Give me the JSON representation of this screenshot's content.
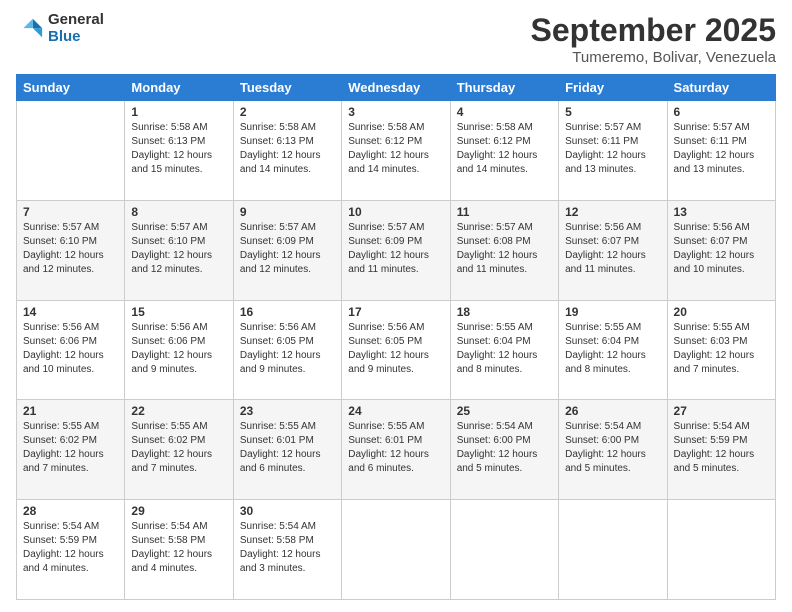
{
  "logo": {
    "general": "General",
    "blue": "Blue"
  },
  "title": "September 2025",
  "subtitle": "Tumeremo, Bolivar, Venezuela",
  "weekdays": [
    "Sunday",
    "Monday",
    "Tuesday",
    "Wednesday",
    "Thursday",
    "Friday",
    "Saturday"
  ],
  "weeks": [
    [
      {
        "day": "",
        "sunrise": "",
        "sunset": "",
        "daylight": ""
      },
      {
        "day": "1",
        "sunrise": "Sunrise: 5:58 AM",
        "sunset": "Sunset: 6:13 PM",
        "daylight": "Daylight: 12 hours and 15 minutes."
      },
      {
        "day": "2",
        "sunrise": "Sunrise: 5:58 AM",
        "sunset": "Sunset: 6:13 PM",
        "daylight": "Daylight: 12 hours and 14 minutes."
      },
      {
        "day": "3",
        "sunrise": "Sunrise: 5:58 AM",
        "sunset": "Sunset: 6:12 PM",
        "daylight": "Daylight: 12 hours and 14 minutes."
      },
      {
        "day": "4",
        "sunrise": "Sunrise: 5:58 AM",
        "sunset": "Sunset: 6:12 PM",
        "daylight": "Daylight: 12 hours and 14 minutes."
      },
      {
        "day": "5",
        "sunrise": "Sunrise: 5:57 AM",
        "sunset": "Sunset: 6:11 PM",
        "daylight": "Daylight: 12 hours and 13 minutes."
      },
      {
        "day": "6",
        "sunrise": "Sunrise: 5:57 AM",
        "sunset": "Sunset: 6:11 PM",
        "daylight": "Daylight: 12 hours and 13 minutes."
      }
    ],
    [
      {
        "day": "7",
        "sunrise": "Sunrise: 5:57 AM",
        "sunset": "Sunset: 6:10 PM",
        "daylight": "Daylight: 12 hours and 12 minutes."
      },
      {
        "day": "8",
        "sunrise": "Sunrise: 5:57 AM",
        "sunset": "Sunset: 6:10 PM",
        "daylight": "Daylight: 12 hours and 12 minutes."
      },
      {
        "day": "9",
        "sunrise": "Sunrise: 5:57 AM",
        "sunset": "Sunset: 6:09 PM",
        "daylight": "Daylight: 12 hours and 12 minutes."
      },
      {
        "day": "10",
        "sunrise": "Sunrise: 5:57 AM",
        "sunset": "Sunset: 6:09 PM",
        "daylight": "Daylight: 12 hours and 11 minutes."
      },
      {
        "day": "11",
        "sunrise": "Sunrise: 5:57 AM",
        "sunset": "Sunset: 6:08 PM",
        "daylight": "Daylight: 12 hours and 11 minutes."
      },
      {
        "day": "12",
        "sunrise": "Sunrise: 5:56 AM",
        "sunset": "Sunset: 6:07 PM",
        "daylight": "Daylight: 12 hours and 11 minutes."
      },
      {
        "day": "13",
        "sunrise": "Sunrise: 5:56 AM",
        "sunset": "Sunset: 6:07 PM",
        "daylight": "Daylight: 12 hours and 10 minutes."
      }
    ],
    [
      {
        "day": "14",
        "sunrise": "Sunrise: 5:56 AM",
        "sunset": "Sunset: 6:06 PM",
        "daylight": "Daylight: 12 hours and 10 minutes."
      },
      {
        "day": "15",
        "sunrise": "Sunrise: 5:56 AM",
        "sunset": "Sunset: 6:06 PM",
        "daylight": "Daylight: 12 hours and 9 minutes."
      },
      {
        "day": "16",
        "sunrise": "Sunrise: 5:56 AM",
        "sunset": "Sunset: 6:05 PM",
        "daylight": "Daylight: 12 hours and 9 minutes."
      },
      {
        "day": "17",
        "sunrise": "Sunrise: 5:56 AM",
        "sunset": "Sunset: 6:05 PM",
        "daylight": "Daylight: 12 hours and 9 minutes."
      },
      {
        "day": "18",
        "sunrise": "Sunrise: 5:55 AM",
        "sunset": "Sunset: 6:04 PM",
        "daylight": "Daylight: 12 hours and 8 minutes."
      },
      {
        "day": "19",
        "sunrise": "Sunrise: 5:55 AM",
        "sunset": "Sunset: 6:04 PM",
        "daylight": "Daylight: 12 hours and 8 minutes."
      },
      {
        "day": "20",
        "sunrise": "Sunrise: 5:55 AM",
        "sunset": "Sunset: 6:03 PM",
        "daylight": "Daylight: 12 hours and 7 minutes."
      }
    ],
    [
      {
        "day": "21",
        "sunrise": "Sunrise: 5:55 AM",
        "sunset": "Sunset: 6:02 PM",
        "daylight": "Daylight: 12 hours and 7 minutes."
      },
      {
        "day": "22",
        "sunrise": "Sunrise: 5:55 AM",
        "sunset": "Sunset: 6:02 PM",
        "daylight": "Daylight: 12 hours and 7 minutes."
      },
      {
        "day": "23",
        "sunrise": "Sunrise: 5:55 AM",
        "sunset": "Sunset: 6:01 PM",
        "daylight": "Daylight: 12 hours and 6 minutes."
      },
      {
        "day": "24",
        "sunrise": "Sunrise: 5:55 AM",
        "sunset": "Sunset: 6:01 PM",
        "daylight": "Daylight: 12 hours and 6 minutes."
      },
      {
        "day": "25",
        "sunrise": "Sunrise: 5:54 AM",
        "sunset": "Sunset: 6:00 PM",
        "daylight": "Daylight: 12 hours and 5 minutes."
      },
      {
        "day": "26",
        "sunrise": "Sunrise: 5:54 AM",
        "sunset": "Sunset: 6:00 PM",
        "daylight": "Daylight: 12 hours and 5 minutes."
      },
      {
        "day": "27",
        "sunrise": "Sunrise: 5:54 AM",
        "sunset": "Sunset: 5:59 PM",
        "daylight": "Daylight: 12 hours and 5 minutes."
      }
    ],
    [
      {
        "day": "28",
        "sunrise": "Sunrise: 5:54 AM",
        "sunset": "Sunset: 5:59 PM",
        "daylight": "Daylight: 12 hours and 4 minutes."
      },
      {
        "day": "29",
        "sunrise": "Sunrise: 5:54 AM",
        "sunset": "Sunset: 5:58 PM",
        "daylight": "Daylight: 12 hours and 4 minutes."
      },
      {
        "day": "30",
        "sunrise": "Sunrise: 5:54 AM",
        "sunset": "Sunset: 5:58 PM",
        "daylight": "Daylight: 12 hours and 3 minutes."
      },
      {
        "day": "",
        "sunrise": "",
        "sunset": "",
        "daylight": ""
      },
      {
        "day": "",
        "sunrise": "",
        "sunset": "",
        "daylight": ""
      },
      {
        "day": "",
        "sunrise": "",
        "sunset": "",
        "daylight": ""
      },
      {
        "day": "",
        "sunrise": "",
        "sunset": "",
        "daylight": ""
      }
    ]
  ]
}
